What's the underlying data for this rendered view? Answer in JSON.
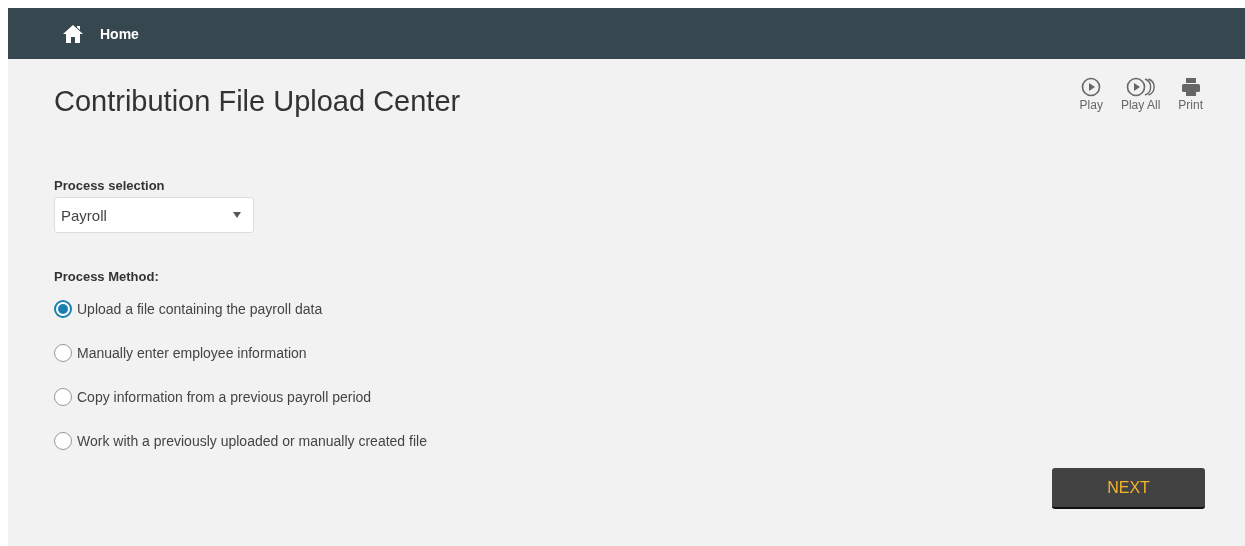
{
  "nav": {
    "home_label": "Home"
  },
  "page_title": "Contribution File Upload Center",
  "toolbar": [
    {
      "kind": "play",
      "label": "Play"
    },
    {
      "kind": "play_all",
      "label": "Play All"
    },
    {
      "kind": "print",
      "label": "Print"
    }
  ],
  "process_selection": {
    "label": "Process selection",
    "value": "Payroll"
  },
  "process_method": {
    "label": "Process Method:",
    "options": [
      {
        "label": "Upload a file containing the payroll data",
        "selected": true
      },
      {
        "label": "Manually enter employee information",
        "selected": false
      },
      {
        "label": "Copy information from a previous payroll period",
        "selected": false
      },
      {
        "label": "Work with a previously uploaded or manually created file",
        "selected": false
      }
    ]
  },
  "next_button": "NEXT"
}
